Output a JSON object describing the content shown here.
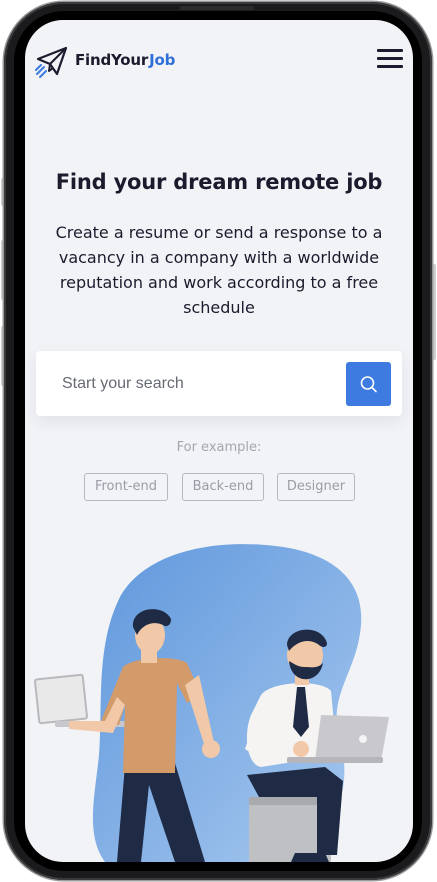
{
  "header": {
    "brand_primary": "FindYour",
    "brand_accent": "Job",
    "logo_icon": "paper-plane-icon",
    "menu_icon": "hamburger-menu-icon"
  },
  "hero": {
    "title": "Find your dream remote job",
    "subtitle": "Create a resume or send a response to a vacancy in a company with a worldwide reputation and work according to a free schedule"
  },
  "search": {
    "placeholder": "Start your search",
    "button_icon": "search-icon"
  },
  "examples": {
    "label": "For example:",
    "tags": [
      "Front-end",
      "Back-end",
      "Designer"
    ]
  },
  "colors": {
    "accent": "#3d7be0",
    "brand_accent": "#2f6fd8",
    "text_dark": "#1a1c2e",
    "background": "#f2f3f7",
    "blob": "#7fb0e6"
  }
}
